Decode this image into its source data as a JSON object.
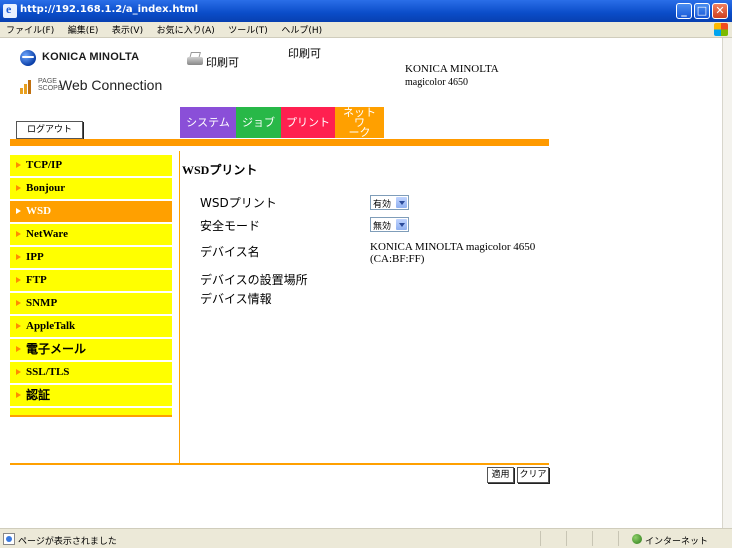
{
  "window": {
    "title": "http://192.168.1.2/a_index.html"
  },
  "menubar": {
    "items": [
      "ファイル(F)",
      "編集(E)",
      "表示(V)",
      "お気に入り(A)",
      "ツール(T)",
      "ヘルプ(H)"
    ]
  },
  "header": {
    "brand": "KONICA MINOLTA",
    "pagescope_top": "PAGE",
    "pagescope_bottom": "SCOPE",
    "product": "Web Connection",
    "status_icon_text": "印刷可",
    "status_text": "印刷可",
    "device_manufacturer": "KONICA MINOLTA",
    "device_model": "magicolor 4650",
    "logout_label": "ログアウト"
  },
  "tabs": [
    {
      "label": "システム",
      "color": "#8a4fd8"
    },
    {
      "label": "ジョブ",
      "color": "#28b848"
    },
    {
      "label": "プリント",
      "color": "#ff2050"
    },
    {
      "label": "ネットワーク",
      "label_line1": "ネットワ",
      "label_line2": "ーク",
      "color": "#ffa000",
      "active": true
    }
  ],
  "sidebar": {
    "items": [
      {
        "label": "TCP/IP"
      },
      {
        "label": "Bonjour"
      },
      {
        "label": "WSD",
        "active": true
      },
      {
        "label": "NetWare"
      },
      {
        "label": "IPP"
      },
      {
        "label": "FTP"
      },
      {
        "label": "SNMP"
      },
      {
        "label": "AppleTalk"
      },
      {
        "label": "電子メール"
      },
      {
        "label": "SSL/TLS"
      },
      {
        "label": "認証"
      }
    ]
  },
  "main": {
    "title_prefix": "WSD",
    "title_suffix": "プリント",
    "rows": {
      "wsd_print": {
        "label": "WSDプリント",
        "value": "有効"
      },
      "secure_mode": {
        "label": "安全モード",
        "value": "無効"
      },
      "device_name": {
        "label": "デバイス名",
        "value_line1": "KONICA MINOLTA magicolor 4650",
        "value_line2": "(CA:BF:FF)"
      },
      "location": {
        "label": "デバイスの設置場所"
      },
      "info": {
        "label": "デバイス情報"
      }
    },
    "apply_label": "適用",
    "clear_label": "クリア"
  },
  "statusbar": {
    "message": "ページが表示されました",
    "zone": "インターネット"
  },
  "colors": {
    "accent_orange": "#ffa000",
    "sidebar_yellow": "#ffff00",
    "titlebar_blue": "#0a4cc8"
  }
}
